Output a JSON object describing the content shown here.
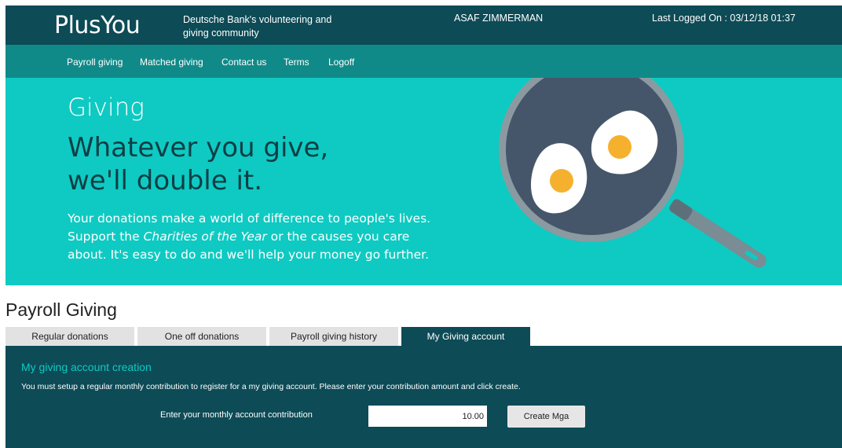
{
  "header": {
    "logo_text": "PlusYou",
    "tagline": "Deutsche Bank's volunteering and giving community",
    "username": "ASAF ZIMMERMAN",
    "last_logged": "Last Logged On : 03/12/18 01:37"
  },
  "nav": {
    "items": [
      {
        "label": "Payroll giving"
      },
      {
        "label": "Matched giving"
      },
      {
        "label": "Contact us"
      },
      {
        "label": "Terms"
      },
      {
        "label": "Logoff"
      }
    ]
  },
  "hero": {
    "kicker": "Giving",
    "headline_line1": "Whatever you give,",
    "headline_line2": "we'll double it.",
    "body_part1": "Your donations make a world of difference to people's lives. Support the ",
    "body_emph": "Charities of the Year",
    "body_part2": " or the causes you care about. It's easy to do and we'll help your money go further.",
    "illustration_icon": "frying-pan-eggs-icon"
  },
  "section": {
    "title": "Payroll Giving",
    "tabs": [
      {
        "label": "Regular donations"
      },
      {
        "label": "One off donations"
      },
      {
        "label": "Payroll giving history"
      },
      {
        "label": "My Giving account"
      }
    ],
    "active_tab": "My Giving account"
  },
  "panel": {
    "title": "My giving account creation",
    "description": "You must setup a regular monthly contribution to register for a my giving account. Please enter your contribution amount and click create.",
    "contribution_label": "Enter your monthly account contribution",
    "contribution_value": "10.00",
    "create_button": "Create Mga"
  },
  "colors": {
    "header_bg": "#0d4b56",
    "nav_bg": "#108a88",
    "hero_bg": "#0ecac2",
    "accent": "#0ecac2",
    "tab_inactive": "#e2e2e2"
  }
}
